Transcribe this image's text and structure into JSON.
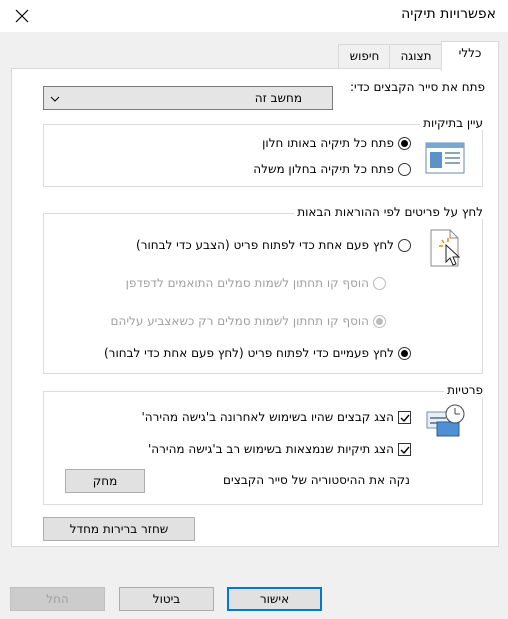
{
  "window": {
    "title": "אפשרויות תיקיה"
  },
  "tabs": [
    {
      "label": "כללי",
      "active": true
    },
    {
      "label": "תצוגה"
    },
    {
      "label": "חיפוש"
    }
  ],
  "open_explorer": {
    "label": "פתח את סייר הקבצים כדי:",
    "value": "מחשב זה"
  },
  "browse": {
    "title": "עיין בתיקיות",
    "options": [
      {
        "label": "פתח כל תיקיה באותו חלון",
        "selected": true
      },
      {
        "label": "פתח כל תיקיה בחלון משלה",
        "selected": false
      }
    ]
  },
  "click": {
    "title": "לחץ על פריטים לפי ההוראות הבאות",
    "single": "לחץ פעם אחת כדי לפתוח פריט (הצבע כדי לבחור)",
    "underline_browser": "הוסף קו תחתון לשמות סמלים התואמים לדפדפן",
    "underline_hover": "הוסף קו תחתון לשמות סמלים רק כשאצביע עליהם",
    "double": "לחץ פעמיים כדי לפתוח פריט (לחץ פעם אחת כדי לבחור)"
  },
  "privacy": {
    "title": "פרטיות",
    "recent_files": "הצג קבצים שהיו בשימוש לאחרונה ב'גישה מהירה'",
    "frequent_folders": "הצג תיקיות שנמצאות בשימוש רב ב'גישה מהירה'",
    "clear_label": "נקה את ההיסטוריה של סייר הקבצים",
    "clear_button": "מחק"
  },
  "restore_button": "שחזר ברירות מחדל",
  "footer": {
    "ok": "אישור",
    "cancel": "ביטול",
    "apply": "החל"
  }
}
